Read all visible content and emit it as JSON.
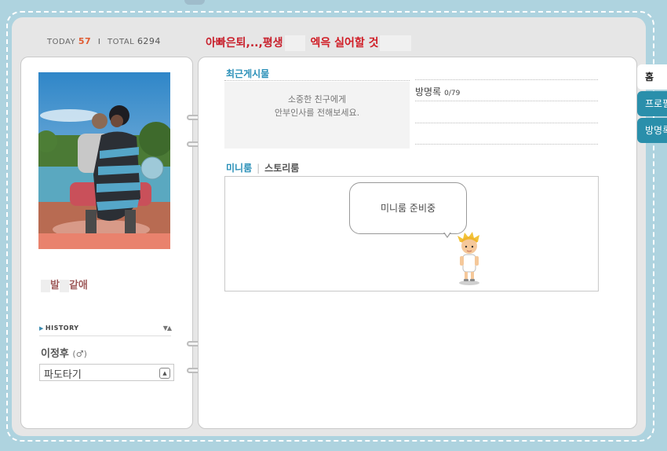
{
  "header": {
    "today_label": "TODAY",
    "today_value": "57",
    "separator": "I",
    "total_label": "TOTAL",
    "total_value": "6294"
  },
  "title": {
    "part1": "아빠은퇴,..,평생",
    "part2": "엑윽 실어할 것"
  },
  "profile": {
    "status_part1": "발",
    "status_part2": "같애"
  },
  "history": {
    "label": "HISTORY",
    "name": "이정후",
    "gender": "(♂)",
    "select_value": "파도타기"
  },
  "recent_posts": {
    "title": "최근게시물",
    "notice_line1": "소중한 친구에게",
    "notice_line2": "안부인사를 전해보세요."
  },
  "guestbook": {
    "label": "방명록",
    "count": "0/79"
  },
  "room_tabs": {
    "active": "미니룸",
    "separator": "|",
    "inactive": "스토리룸"
  },
  "miniroom": {
    "bubble_text": "미니룸 준비중"
  },
  "side_tabs": {
    "home": "홈",
    "profile": "프로필",
    "guestbook": "방명록"
  },
  "colors": {
    "accent": "#2a90b8",
    "title_red": "#c8202c",
    "background": "#aed3df"
  }
}
